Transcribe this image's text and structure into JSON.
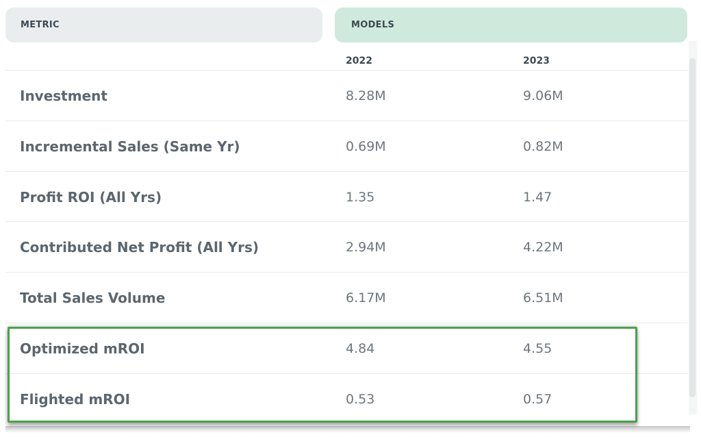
{
  "header": {
    "metric_label": "METRIC",
    "models_label": "MODELS"
  },
  "years": [
    "2022",
    "2023"
  ],
  "rows": [
    {
      "metric": "Investment",
      "v2022": "8.28M",
      "v2023": "9.06M"
    },
    {
      "metric": "Incremental Sales (Same Yr)",
      "v2022": "0.69M",
      "v2023": "0.82M"
    },
    {
      "metric": "Profit ROI (All Yrs)",
      "v2022": "1.35",
      "v2023": "1.47"
    },
    {
      "metric": "Contributed Net Profit (All Yrs)",
      "v2022": "2.94M",
      "v2023": "4.22M"
    },
    {
      "metric": "Total Sales Volume",
      "v2022": "6.17M",
      "v2023": "6.51M"
    },
    {
      "metric": "Optimized mROI",
      "v2022": "4.84",
      "v2023": "4.55"
    },
    {
      "metric": "Flighted mROI",
      "v2022": "0.53",
      "v2023": "0.57"
    }
  ],
  "colors": {
    "metric_header_bg": "#e9edee",
    "models_header_bg": "#d0e9dd",
    "highlight_border": "#4aa14a"
  }
}
